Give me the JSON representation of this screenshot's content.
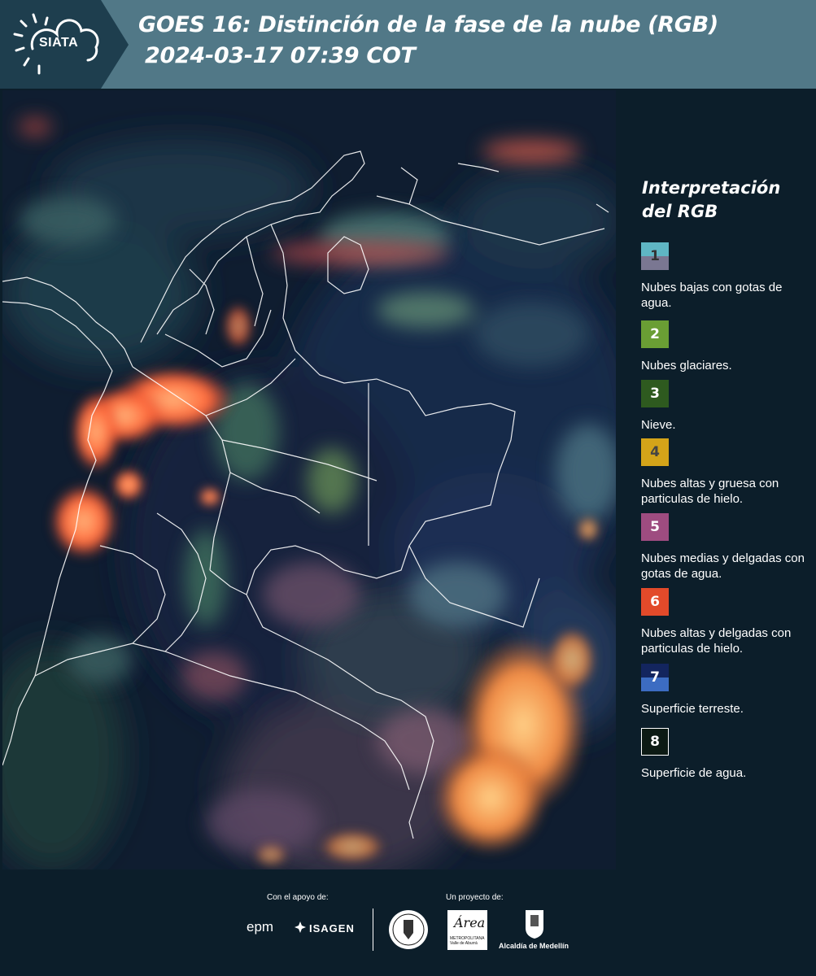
{
  "header": {
    "logo_text": "SIATA",
    "title_line1": "GOES 16: Distinción de la fase de la nube (RGB)",
    "title_line2": "2024-03-17 07:39 COT",
    "bar_color": "#517887",
    "logo_color": "#1e3e4e"
  },
  "legend": {
    "title": "Interpretación del RGB",
    "items": [
      {
        "number": "1",
        "top_color": "#5fb6c4",
        "bottom_color": "#7a7792",
        "number_color": "#333333",
        "description": "Nubes bajas con gotas de agua."
      },
      {
        "number": "2",
        "top_color": "#6a9e34",
        "bottom_color": "#6a9e34",
        "number_color": "#ffffff",
        "description": "Nubes glaciares."
      },
      {
        "number": "3",
        "top_color": "#2e5a1f",
        "bottom_color": "#2e5a1f",
        "number_color": "#ffffff",
        "description": "Nieve."
      },
      {
        "number": "4",
        "top_color": "#d4a419",
        "bottom_color": "#d4a419",
        "number_color": "#444444",
        "description": "Nubes altas y gruesa con particulas de hielo."
      },
      {
        "number": "5",
        "top_color": "#9e4c80",
        "bottom_color": "#9e4c80",
        "number_color": "#ffffff",
        "description": "Nubes medias y delgadas con gotas de agua."
      },
      {
        "number": "6",
        "top_color": "#e24a2a",
        "bottom_color": "#e24a2a",
        "number_color": "#ffffff",
        "description": "Nubes altas y delgadas con particulas de hielo."
      },
      {
        "number": "7",
        "top_color": "#13255e",
        "bottom_color": "#3c6cc2",
        "number_color": "#ffffff",
        "description": "Superficie terreste."
      },
      {
        "number": "8",
        "top_color": "#0c1a14",
        "bottom_color": "#0c1a14",
        "number_color": "#ffffff",
        "description": "Superficie de agua."
      }
    ]
  },
  "footer": {
    "support_label": "Con el apoyo de:",
    "project_label": "Un proyecto de:",
    "sponsors": [
      "epm",
      "ISAGEN"
    ],
    "area_logo_title": "Área",
    "area_logo_subtitle": "METROPOLITANA Valle de Aburrá",
    "alcaldia_label": "Alcaldía de Medellín"
  }
}
